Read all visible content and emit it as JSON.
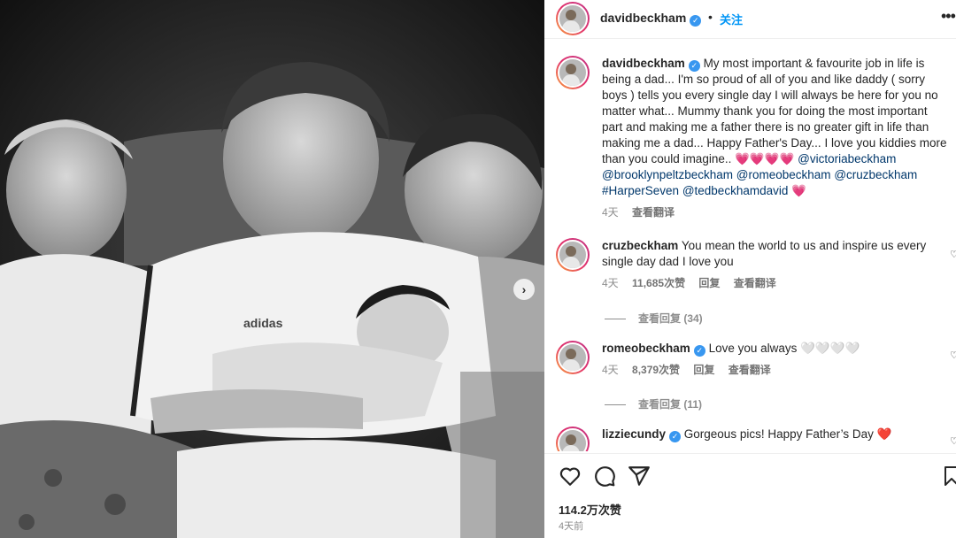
{
  "post": {
    "username": "davidbeckham",
    "follow_label": "关注",
    "separator": "•",
    "more_label": "•••"
  },
  "caption": {
    "username": "davidbeckham",
    "text": "My most important & favourite job in life is being a dad... I'm so proud of all of you and like daddy ( sorry boys ) tells you every single day I will always be here for you no matter what... Mummy thank you for doing the most important part and making me a father there is no greater gift in life than making me a dad... Happy Father's Day... I love you kiddies more than you could imagine.. 💗💗💗💗",
    "mention1": "@victoriabeckham",
    "mention2": "@brooklynpeltzbeckham",
    "mention3": "@romeobeckham",
    "mention4": "@cruzbeckham",
    "mention5": "#HarperSeven",
    "mention6": "@tedbeckhamdavid",
    "mention_end": "💗",
    "time": "4天",
    "translate": "查看翻译"
  },
  "comments": [
    {
      "username": "cruzbeckham",
      "verified": false,
      "text": "You mean the world to us and inspire us every single day dad I love you",
      "time": "4天",
      "likes": "11,685次赞",
      "reply": "回复",
      "translate": "查看翻译",
      "view_replies": "查看回复 (34)"
    },
    {
      "username": "romeobeckham",
      "verified": true,
      "text": "Love you always 🤍🤍🤍🤍",
      "time": "4天",
      "likes": "8,379次赞",
      "reply": "回复",
      "translate": "查看翻译",
      "view_replies": "查看回复 (11)"
    },
    {
      "username": "lizziecundy",
      "verified": true,
      "text": "Gorgeous pics! Happy Father’s Day ❤️"
    }
  ],
  "footer": {
    "likes": "114.2万次赞",
    "ago": "4天前"
  },
  "icons": {
    "like": "heart-icon",
    "comment": "comment-icon",
    "share": "share-icon",
    "save": "bookmark-icon",
    "next": "chevron-right-icon"
  },
  "colors": {
    "link": "#00376b",
    "follow": "#0095f6",
    "verified": "#3897f0",
    "muted": "#8e8e8e"
  }
}
